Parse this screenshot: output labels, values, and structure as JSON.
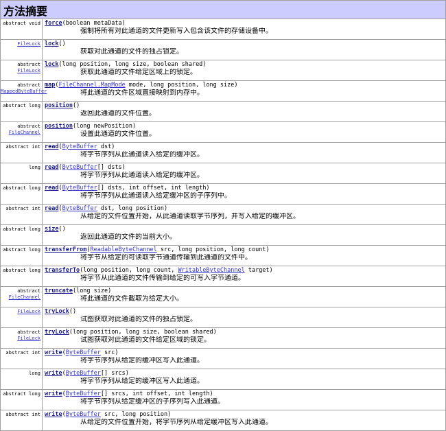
{
  "title": "方法摘要",
  "methods": [
    {
      "mod": [
        "abstract  void"
      ],
      "name": "force",
      "sig": [
        {
          "t": "(boolean metaData)"
        }
      ],
      "desc": "强制将所有对此通道的文件更新写入包含该文件的存储设备中。"
    },
    {
      "mod": [
        {
          "link": "FileLock"
        }
      ],
      "name": "lock",
      "sig": [
        {
          "t": "()"
        }
      ],
      "desc": "获取对此通道的文件的独占锁定。"
    },
    {
      "mod": [
        "abstract",
        {
          "link": "FileLock"
        }
      ],
      "name": "lock",
      "sig": [
        {
          "t": "(long position, long size, boolean shared)"
        }
      ],
      "desc": "获取此通道的文件给定区域上的锁定。"
    },
    {
      "mod": [
        "abstract",
        {
          "link": "MappedByteBuffer"
        }
      ],
      "name": "map",
      "sig": [
        {
          "t": "("
        },
        {
          "link": "FileChannel.MapMode"
        },
        {
          "t": " mode, long position, long size)"
        }
      ],
      "desc": "将此通道的文件区域直接映射到内存中。"
    },
    {
      "mod": [
        "abstract  long"
      ],
      "name": "position",
      "sig": [
        {
          "t": "()"
        }
      ],
      "desc": "返回此通道的文件位置。"
    },
    {
      "mod": [
        "abstract",
        {
          "link": "FileChannel"
        }
      ],
      "name": "position",
      "sig": [
        {
          "t": "(long newPosition)"
        }
      ],
      "desc": "设置此通道的文件位置。"
    },
    {
      "mod": [
        "abstract  int"
      ],
      "name": "read",
      "sig": [
        {
          "t": "("
        },
        {
          "link": "ByteBuffer"
        },
        {
          "t": " dst)"
        }
      ],
      "desc": "将字节序列从此通道读入给定的缓冲区。"
    },
    {
      "mod": [
        "long"
      ],
      "name": "read",
      "sig": [
        {
          "t": "("
        },
        {
          "link": "ByteBuffer"
        },
        {
          "t": "[] dsts)"
        }
      ],
      "desc": "将字节序列从此通道读入给定的缓冲区。"
    },
    {
      "mod": [
        "abstract  long"
      ],
      "name": "read",
      "sig": [
        {
          "t": "("
        },
        {
          "link": "ByteBuffer"
        },
        {
          "t": "[] dsts, int offset, int length)"
        }
      ],
      "desc": "将字节序列从此通道读入给定缓冲区的子序列中。"
    },
    {
      "mod": [
        "abstract  int"
      ],
      "name": "read",
      "sig": [
        {
          "t": "("
        },
        {
          "link": "ByteBuffer"
        },
        {
          "t": " dst, long position)"
        }
      ],
      "desc": "从给定的文件位置开始，从此通道读取字节序列，并写入给定的缓冲区。"
    },
    {
      "mod": [
        "abstract  long"
      ],
      "name": "size",
      "sig": [
        {
          "t": "()"
        }
      ],
      "desc": "返回此通道的文件的当前大小。"
    },
    {
      "mod": [
        "abstract  long"
      ],
      "name": "transferFrom",
      "sig": [
        {
          "t": "("
        },
        {
          "link": "ReadableByteChannel"
        },
        {
          "t": " src, long position, long count)"
        }
      ],
      "desc": "将字节从给定的可读取字节通道传输到此通道的文件中。"
    },
    {
      "mod": [
        "abstract  long"
      ],
      "name": "transferTo",
      "sig": [
        {
          "t": "(long position, long count, "
        },
        {
          "link": "WritableByteChannel"
        },
        {
          "t": " target)"
        }
      ],
      "desc": "将字节从此通道的文件传输到给定的可写入字节通道。"
    },
    {
      "mod": [
        "abstract",
        {
          "link": "FileChannel"
        }
      ],
      "name": "truncate",
      "sig": [
        {
          "t": "(long size)"
        }
      ],
      "desc": "将此通道的文件截取为给定大小。"
    },
    {
      "mod": [
        {
          "link": "FileLock"
        }
      ],
      "name": "tryLock",
      "sig": [
        {
          "t": "()"
        }
      ],
      "desc": "试图获取对此通道的文件的独占锁定。"
    },
    {
      "mod": [
        "abstract",
        {
          "link": "FileLock"
        }
      ],
      "name": "tryLock",
      "sig": [
        {
          "t": "(long position, long size, boolean shared)"
        }
      ],
      "desc": "试图获取对此通道的文件给定区域的锁定。"
    },
    {
      "mod": [
        "abstract  int"
      ],
      "name": "write",
      "sig": [
        {
          "t": "("
        },
        {
          "link": "ByteBuffer"
        },
        {
          "t": " src)"
        }
      ],
      "desc": "将字节序列从给定的缓冲区写入此通道。"
    },
    {
      "mod": [
        "long"
      ],
      "name": "write",
      "sig": [
        {
          "t": "("
        },
        {
          "link": "ByteBuffer"
        },
        {
          "t": "[] srcs)"
        }
      ],
      "desc": "将字节序列从给定的缓冲区写入此通道。"
    },
    {
      "mod": [
        "abstract  long"
      ],
      "name": "write",
      "sig": [
        {
          "t": "("
        },
        {
          "link": "ByteBuffer"
        },
        {
          "t": "[] srcs, int offset, int length)"
        }
      ],
      "desc": "将字节序列从给定缓冲区的子序列写入此通道。"
    },
    {
      "mod": [
        "abstract  int"
      ],
      "name": "write",
      "sig": [
        {
          "t": "("
        },
        {
          "link": "ByteBuffer"
        },
        {
          "t": " src, long position)"
        }
      ],
      "desc": "从给定的文件位置开始，将字节序列从给定缓冲区写入此通道。"
    }
  ]
}
